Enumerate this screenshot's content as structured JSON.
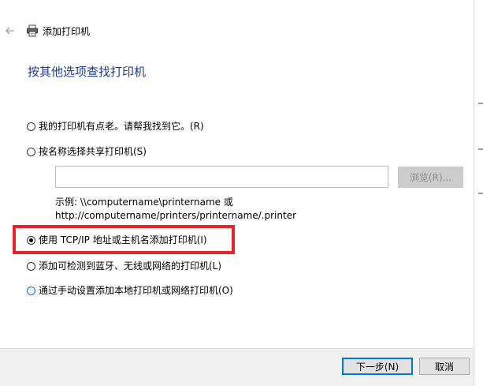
{
  "window": {
    "title": "添加打印机"
  },
  "page": {
    "title": "按其他选项查找打印机"
  },
  "options": [
    {
      "label": "我的打印机有点老。请帮我找到它。(R)",
      "checked": false
    },
    {
      "label": "按名称选择共享打印机(S)",
      "checked": false
    },
    {
      "label": "使用 TCP/IP 地址或主机名添加打印机(I)",
      "checked": true
    },
    {
      "label": "添加可检测到蓝牙、无线或网络的打印机(L)",
      "checked": false
    },
    {
      "label": "通过手动设置添加本地打印机或网络打印机(O)",
      "checked": false
    }
  ],
  "share": {
    "input_value": "",
    "browse_label": "浏览(R)...",
    "example_line1": "示例: \\\\computername\\printername 或",
    "example_line2": "http://computername/printers/printername/.printer"
  },
  "footer": {
    "next_label": "下一步(N)",
    "cancel_label": "取消"
  },
  "colors": {
    "title_blue": "#1c3d91",
    "highlight_red": "#e8242a",
    "focus_blue": "#0078d7"
  }
}
